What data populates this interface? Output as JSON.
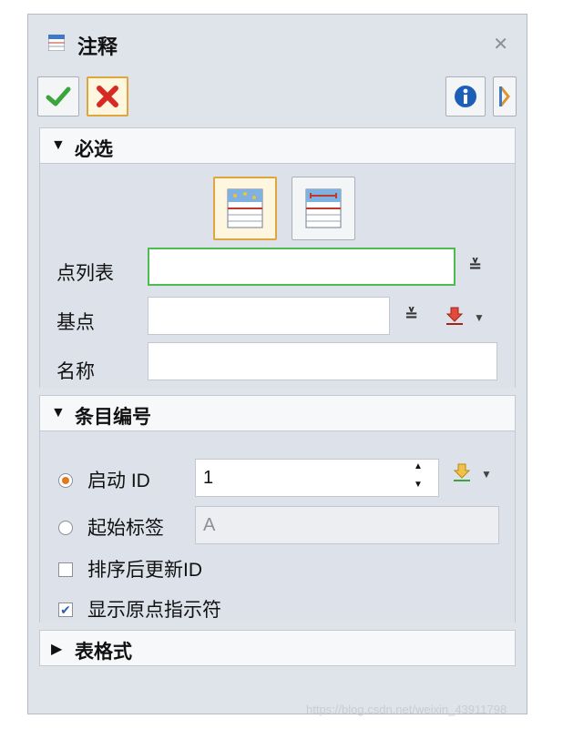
{
  "dialog": {
    "title": "注释",
    "close_icon": "close-icon"
  },
  "toolbar": {
    "ok_icon": "checkmark-icon",
    "cancel_icon": "cancel-x-icon",
    "info_icon": "info-icon",
    "help_icon": "help-icon"
  },
  "sections": {
    "required": {
      "label": "必选",
      "expanded": true
    },
    "numbering": {
      "label": "条目编号",
      "expanded": true
    },
    "format": {
      "label": "表格式",
      "expanded": false
    }
  },
  "required": {
    "point_list_label": "点列表",
    "point_list_value": "",
    "base_point_label": "基点",
    "base_point_value": "",
    "name_label": "名称",
    "name_value": ""
  },
  "numbering": {
    "start_id_label": "启动 ID",
    "start_id_value": "1",
    "start_id_selected": true,
    "start_label_label": "起始标签",
    "start_label_value": "A",
    "renumber_label": "排序后更新ID",
    "renumber_checked": false,
    "show_origin_label": "显示原点指示符",
    "show_origin_checked": true
  },
  "watermark": "https://blog.csdn.net/weixin_43911798"
}
